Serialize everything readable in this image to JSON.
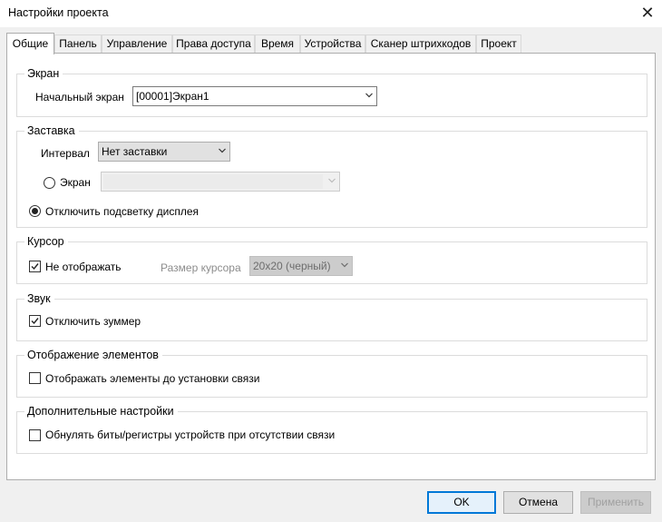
{
  "window": {
    "title": "Настройки проекта",
    "close": "✕"
  },
  "tabs": [
    "Общие",
    "Панель",
    "Управление",
    "Права доступа",
    "Время",
    "Устройства",
    "Сканер штрихкодов",
    "Проект"
  ],
  "screen_group": {
    "legend": "Экран",
    "start_label": "Начальный экран",
    "start_value": "[00001]Экран1"
  },
  "screensaver_group": {
    "legend": "Заставка",
    "interval_label": "Интервал",
    "interval_value": "Нет заставки",
    "screen_radio_label": "Экран",
    "screen_value": "",
    "backlight_radio_label": "Отключить подсветку дисплея",
    "selected": "backlight"
  },
  "cursor_group": {
    "legend": "Курсор",
    "hide_label": "Не отображать",
    "hide_checked": true,
    "size_label": "Размер курсора",
    "size_value": "20x20 (черный)"
  },
  "sound_group": {
    "legend": "Звук",
    "buzzer_label": "Отключить зуммер",
    "buzzer_checked": true
  },
  "display_group": {
    "legend": "Отображение элементов",
    "show_label": "Отображать элементы до установки связи",
    "show_checked": false
  },
  "extra_group": {
    "legend": "Дополнительные настройки",
    "reset_label": "Обнулять биты/регистры устройств при отсутствии связи",
    "reset_checked": false
  },
  "buttons": {
    "ok": "OK",
    "cancel": "Отмена",
    "apply": "Применить"
  }
}
